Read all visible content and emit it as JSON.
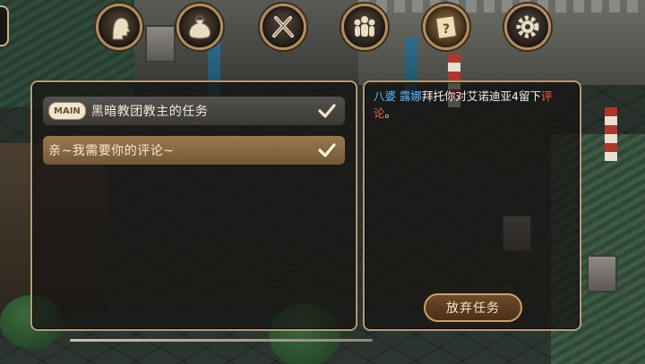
{
  "topbar": {
    "icons": [
      {
        "name": "head-profile-icon",
        "active": false
      },
      {
        "name": "bag-icon",
        "active": false
      },
      {
        "name": "crossed-swords-icon",
        "active": false
      },
      {
        "name": "party-icon",
        "active": false
      },
      {
        "name": "quest-scroll-icon",
        "active": true
      },
      {
        "name": "gear-icon",
        "active": false
      }
    ]
  },
  "quest_list": {
    "items": [
      {
        "badge": "MAIN",
        "title": "黑暗教团教主的任务",
        "selected": false,
        "completed": true
      },
      {
        "badge": "",
        "title": "亲~我需要你的评论~",
        "selected": true,
        "completed": true
      }
    ]
  },
  "quest_detail": {
    "name1": "八婆",
    "name2": "露娜",
    "text_mid": "拜托你对艾诺迪亚4留下",
    "highlight": "评论",
    "text_end": "。"
  },
  "actions": {
    "abandon_label": "放弃任务"
  },
  "colors": {
    "panel_border": "#b69c74",
    "name_blue": "#58b8ff",
    "highlight_red": "#ff5a4e",
    "selected_row": "#a07d50"
  }
}
